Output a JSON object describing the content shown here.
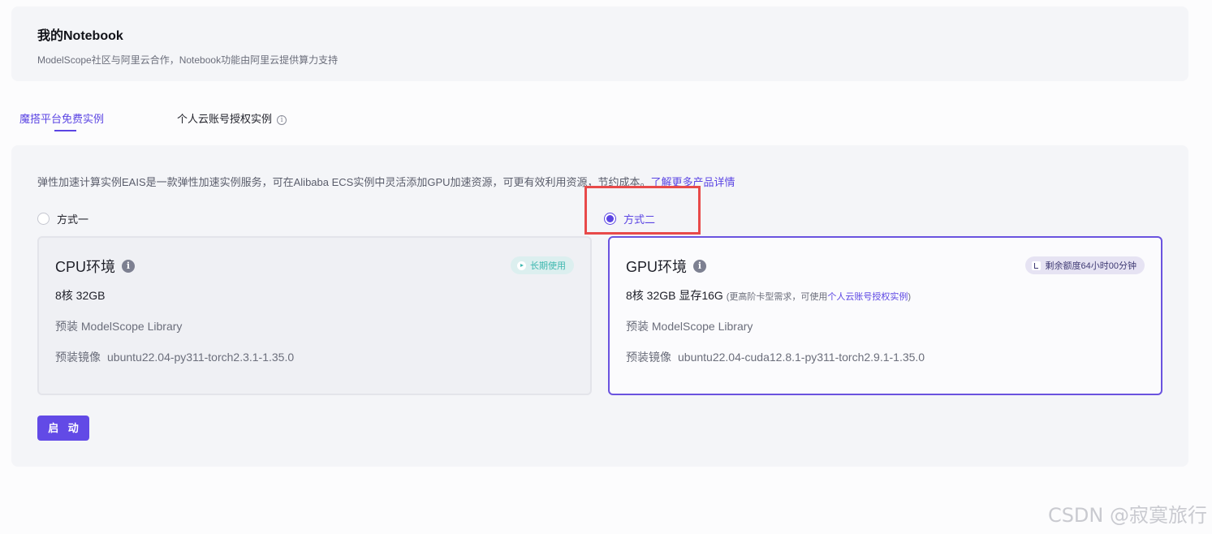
{
  "header": {
    "title": "我的Notebook",
    "subtitle": "ModelScope社区与阿里云合作，Notebook功能由阿里云提供算力支持"
  },
  "tabs": [
    {
      "label": "魔搭平台免费实例",
      "active": true
    },
    {
      "label": "个人云账号授权实例",
      "active": false
    }
  ],
  "panel": {
    "description": "弹性加速计算实例EAIS是一款弹性加速实例服务，可在Alibaba ECS实例中灵活添加GPU加速资源，可更有效利用资源，节约成本。",
    "description_link": "了解更多产品详情",
    "options": [
      {
        "label": "方式一",
        "checked": false
      },
      {
        "label": "方式二",
        "checked": true
      }
    ],
    "cpu": {
      "title": "CPU环境",
      "badge": "长期使用",
      "spec": "8核 32GB",
      "library": "预装 ModelScope Library",
      "image_label": "预装镜像",
      "image_value": "ubuntu22.04-py311-torch2.3.1-1.35.0"
    },
    "gpu": {
      "title": "GPU环境",
      "badge": "剩余额度64小时00分钟",
      "spec": "8核 32GB 显存16G",
      "spec_note_prefix": "(更高阶卡型需求，可使用",
      "spec_note_link": "个人云账号授权实例",
      "spec_note_suffix": ")",
      "library": "预装 ModelScope Library",
      "image_label": "预装镜像",
      "image_value": "ubuntu22.04-cuda12.8.1-py311-torch2.9.1-1.35.0"
    },
    "start_button": "启 动"
  },
  "watermark": "CSDN @寂寞旅行",
  "colors": {
    "accent": "#5b45e3",
    "highlight": "#e84a4a",
    "badge_teal": "#3fb8b0"
  }
}
